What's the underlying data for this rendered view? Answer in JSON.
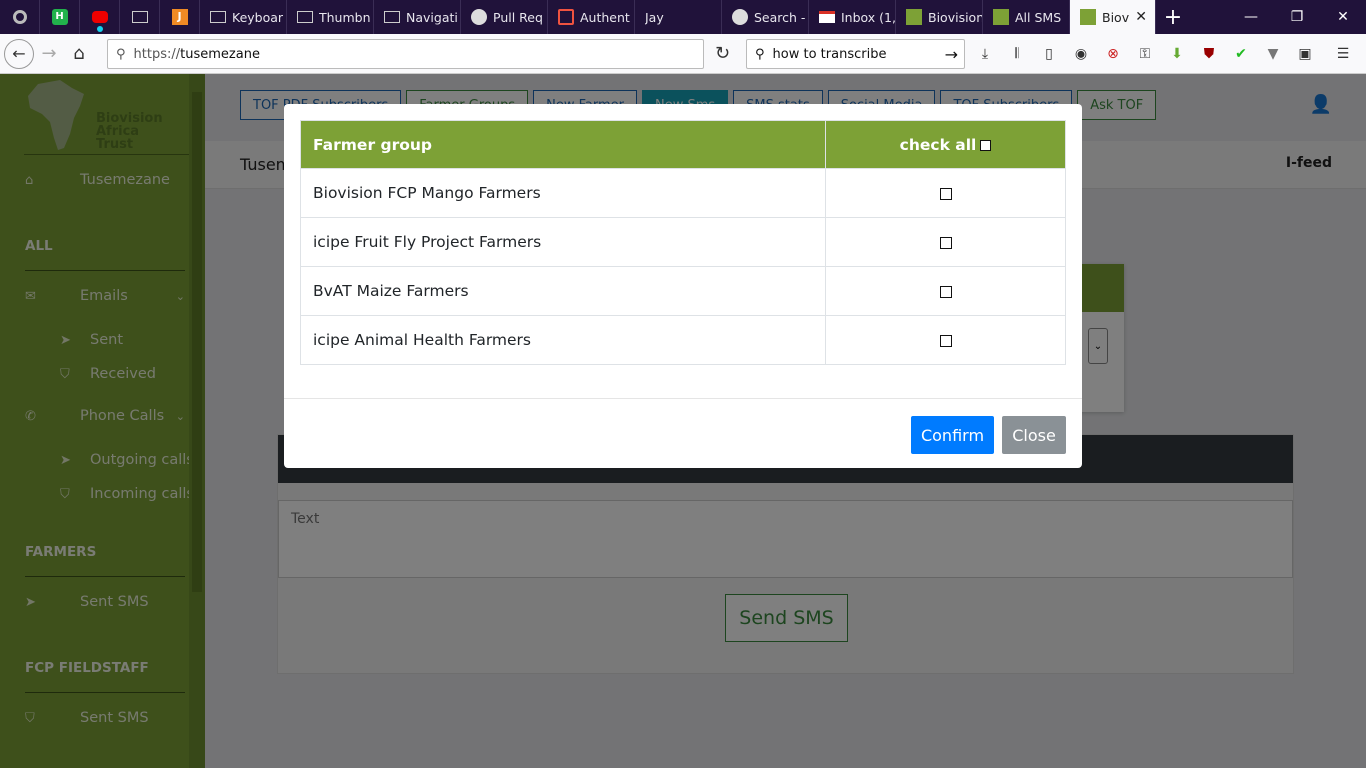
{
  "browser": {
    "tabs": [
      {
        "label": "",
        "icon": "generic-app-icon"
      },
      {
        "label": "",
        "icon": "hubspot-icon"
      },
      {
        "label": "",
        "icon": "youtube-icon"
      },
      {
        "label": "",
        "icon": "monitor-icon"
      },
      {
        "label": "",
        "icon": "jira-icon"
      },
      {
        "label": "Keyboar",
        "icon": "monitor-icon"
      },
      {
        "label": "Thumbn",
        "icon": "monitor-icon"
      },
      {
        "label": "Navigati",
        "icon": "monitor-icon"
      },
      {
        "label": "Pull Req",
        "icon": "github-icon"
      },
      {
        "label": "Authent",
        "icon": "laravel-icon"
      },
      {
        "label": "Jay",
        "icon": ""
      },
      {
        "label": "Search -",
        "icon": "github-icon"
      },
      {
        "label": "Inbox (1,",
        "icon": "gmail-icon"
      },
      {
        "label": "Biovision",
        "icon": "biovision-icon"
      },
      {
        "label": "All SMS",
        "icon": "biovision-icon"
      },
      {
        "label": "Biovi",
        "icon": "biovision-icon"
      }
    ],
    "url_prefix": "https://",
    "url_host": "tusemezane",
    "search_text": "how to transcribe"
  },
  "sidebar": {
    "logo_text": [
      "Biovision",
      "Africa",
      "Trust"
    ],
    "home_label": "Tusemezane",
    "section_all": "ALL",
    "emails": "Emails",
    "emails_sent": "Sent",
    "emails_received": "Received",
    "phone_calls": "Phone Calls",
    "outgoing_calls": "Outgoing calls",
    "incoming_calls": "Incoming calls",
    "section_farmers": "FARMERS",
    "farmers_sent_sms": "Sent SMS",
    "section_fcp": "FCP FIELDSTAFF",
    "fcp_sent_sms": "Sent SMS"
  },
  "main": {
    "top_buttons": [
      "TOF PDF Subscribers",
      "Farmer Groups",
      "New Farmer",
      "New Sms",
      "SMS stats",
      "Social Media",
      "TOF Subscribers",
      "Ask TOF"
    ],
    "page_title": "Tusemezane",
    "feed_label": "I-feed",
    "textarea_placeholder": "Text",
    "send_sms_label": "Send SMS"
  },
  "modal": {
    "col_group": "Farmer group",
    "col_check_all": "check all",
    "rows": [
      {
        "name": "Biovision FCP Mango Farmers",
        "checked": false
      },
      {
        "name": "icipe Fruit Fly Project Farmers",
        "checked": false
      },
      {
        "name": "BvAT Maize Farmers",
        "checked": false
      },
      {
        "name": "icipe Animal Health Farmers",
        "checked": false
      }
    ],
    "confirm_label": "Confirm",
    "close_label": "Close"
  },
  "colors": {
    "brand_green": "#7da136",
    "confirm_blue": "#007bff",
    "close_gray": "#8a9196",
    "tabstrip": "#20123a"
  }
}
